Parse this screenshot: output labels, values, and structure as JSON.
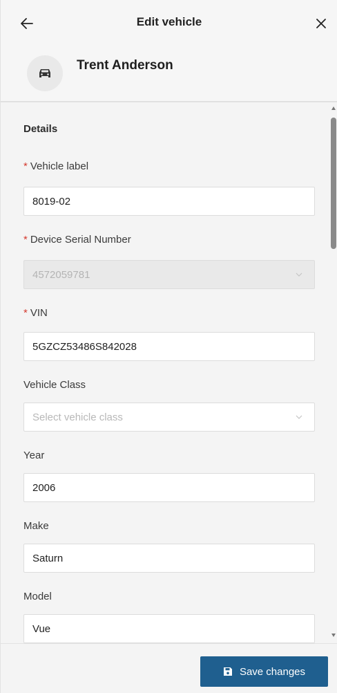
{
  "header": {
    "title": "Edit vehicle",
    "back_icon": "arrow-left-icon",
    "close_icon": "close-icon"
  },
  "owner": {
    "name": "Trent Anderson",
    "icon": "car-icon"
  },
  "details": {
    "section_title": "Details",
    "vehicle_label": {
      "label": "Vehicle label",
      "required": "*",
      "value": "8019-02"
    },
    "device_serial": {
      "label": "Device Serial Number",
      "required": "*",
      "value": "4572059781"
    },
    "vin": {
      "label": "VIN",
      "required": "*",
      "value": "5GZCZ53486S842028"
    },
    "vehicle_class": {
      "label": "Vehicle Class",
      "placeholder": "Select vehicle class"
    },
    "year": {
      "label": "Year",
      "value": "2006"
    },
    "make": {
      "label": "Make",
      "value": "Saturn"
    },
    "model": {
      "label": "Model",
      "value": "Vue"
    }
  },
  "footer": {
    "save_label": "Save changes",
    "save_icon": "floppy-disk-icon"
  },
  "colors": {
    "primary": "#1f5f8f",
    "required": "#d43a2f"
  }
}
